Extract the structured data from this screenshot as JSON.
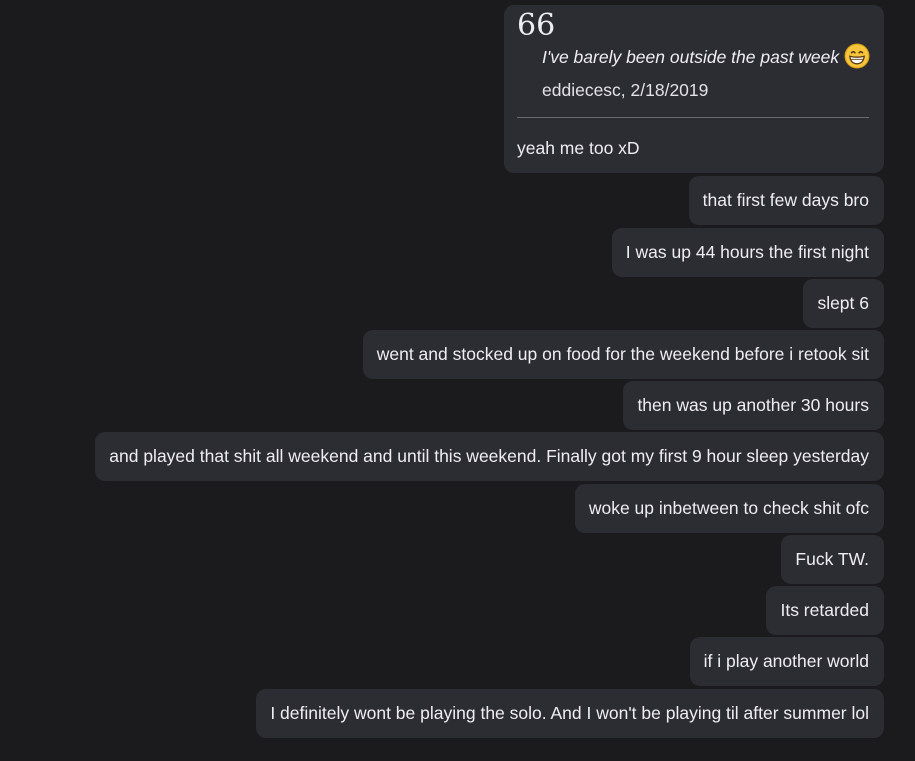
{
  "quote": {
    "mark": "66",
    "text": "I've barely been outside the past week",
    "emoji": "grinning-face-emoji",
    "author_date": "eddiecesc, 2/18/2019",
    "reply": "yeah me too xD"
  },
  "messages": [
    "that first few days bro",
    "I was up 44 hours the first night",
    "slept 6",
    "went and  stocked up on food for the weekend before i retook sit",
    "then was up another 30 hours",
    "and played that shit all weekend and until this weekend. Finally got my first 9 hour sleep yesterday",
    "woke up inbetween to check shit ofc",
    "Fuck TW.",
    "Its retarded",
    "if i play another world",
    "I definitely wont be playing the solo. And I won't be playing til after summer lol"
  ],
  "colors": {
    "background": "#1b1b1e",
    "bubble": "#2c2c33",
    "text": "#eeeef2",
    "divider": "#6a6a72",
    "emoji": "#f6c53b"
  }
}
